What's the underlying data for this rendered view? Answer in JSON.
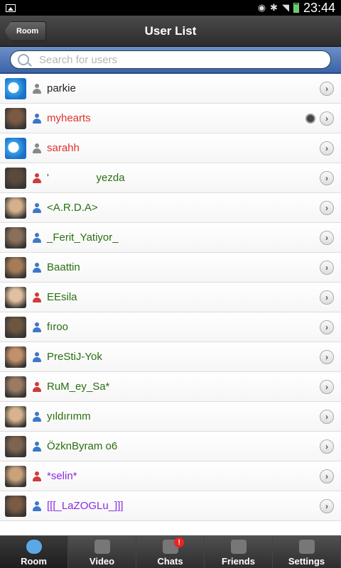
{
  "statusbar": {
    "time": "23:44"
  },
  "titlebar": {
    "back_label": "Room",
    "title": "User List"
  },
  "search": {
    "placeholder": "Search for users"
  },
  "users": [
    {
      "name": "parkie",
      "color": "#222222",
      "gender": "grey",
      "avatar": "app-logo"
    },
    {
      "name": "myhearts",
      "color": "#e03030",
      "gender": "blue",
      "avatar": "photo",
      "camera": true
    },
    {
      "name": "sarahh",
      "color": "#e03030",
      "gender": "grey",
      "avatar": "app-logo"
    },
    {
      "name": "'                yezda",
      "color": "#2a6e12",
      "gender": "red",
      "avatar": "photo"
    },
    {
      "name": "<A.R.D.A>",
      "color": "#2a6e12",
      "gender": "blue",
      "avatar": "photo"
    },
    {
      "name": "_Ferit_Yatiyor_",
      "color": "#2a6e12",
      "gender": "blue",
      "avatar": "photo"
    },
    {
      "name": "Baattin",
      "color": "#2a6e12",
      "gender": "blue",
      "avatar": "photo"
    },
    {
      "name": "EEsila",
      "color": "#2a6e12",
      "gender": "red",
      "avatar": "photo"
    },
    {
      "name": "fıroo",
      "color": "#2a6e12",
      "gender": "blue",
      "avatar": "photo"
    },
    {
      "name": "PreStiJ-Yok",
      "color": "#2a6e12",
      "gender": "blue",
      "avatar": "photo"
    },
    {
      "name": "RuM_ey_Sa*",
      "color": "#2a6e12",
      "gender": "red",
      "avatar": "photo"
    },
    {
      "name": "yıldırımm",
      "color": "#2a6e12",
      "gender": "blue",
      "avatar": "photo"
    },
    {
      "name": "ÖzknByram o6",
      "color": "#2a6e12",
      "gender": "blue",
      "avatar": "photo"
    },
    {
      "name": "*selin*",
      "color": "#8a2be2",
      "gender": "red",
      "avatar": "photo"
    },
    {
      "name": "[[[_LaZOGLu_]]]",
      "color": "#8a2be2",
      "gender": "blue",
      "avatar": "photo"
    }
  ],
  "tabs": [
    {
      "label": "Room",
      "icon": "chat-bubbles-icon",
      "active": true
    },
    {
      "label": "Video",
      "icon": "webcam-icon"
    },
    {
      "label": "Chats",
      "icon": "plus-chat-icon",
      "badge": "!"
    },
    {
      "label": "Friends",
      "icon": "friends-icon"
    },
    {
      "label": "Settings",
      "icon": "wrench-icon"
    }
  ]
}
